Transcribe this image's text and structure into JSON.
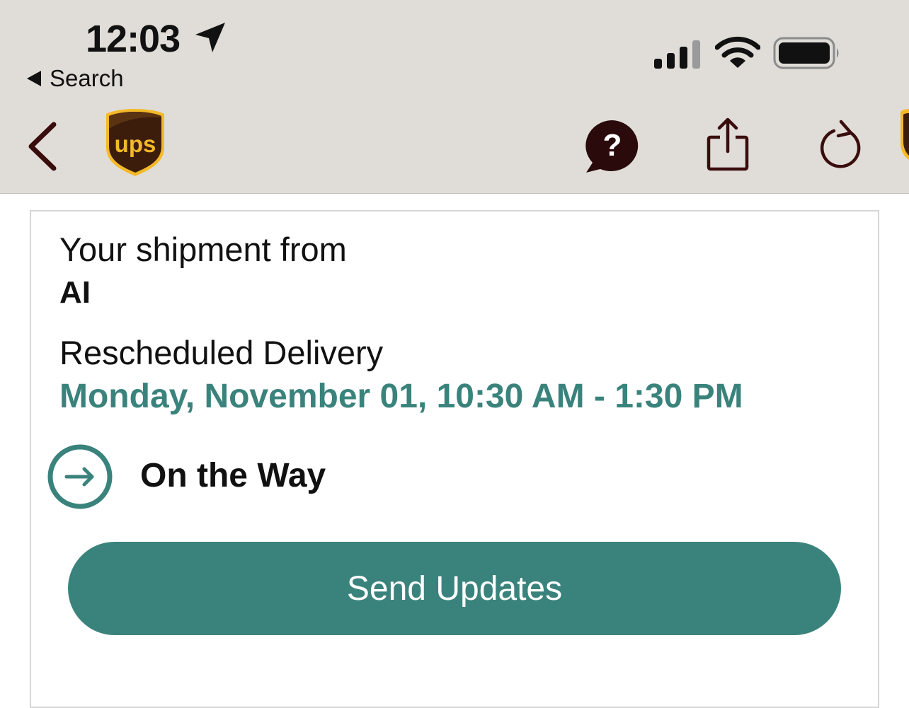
{
  "status_bar": {
    "time": "12:03",
    "back_app": "Search"
  },
  "nav": {
    "logo_text": "ups",
    "icons": [
      "chevron-left-icon",
      "ups-logo",
      "help-icon",
      "share-icon",
      "refresh-icon"
    ]
  },
  "shipment": {
    "from_label": "Your shipment from",
    "sender": "AI",
    "delivery_label": "Rescheduled Delivery",
    "delivery_window": "Monday, November 01, 10:30 AM - 1:30 PM",
    "status": "On the Way"
  },
  "actions": {
    "send_updates": "Send Updates"
  },
  "colors": {
    "accent": "#3a837c",
    "ups_brown": "#3c1d0c",
    "ups_gold": "#f3b928",
    "nav_icon": "#3a0d0d",
    "header_bg": "#e0ddd8"
  }
}
